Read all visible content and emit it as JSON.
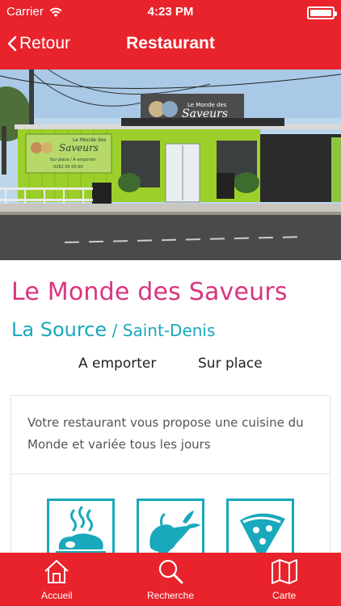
{
  "status_bar": {
    "carrier": "Carrier",
    "time": "4:23 PM",
    "battery_level": 1.0
  },
  "nav": {
    "back_label": "Retour",
    "title": "Restaurant"
  },
  "hero": {
    "sign_line1": "Le Monde des",
    "sign_line2": "Saveurs",
    "wall_line1": "Le Monde des",
    "wall_line2": "Saveurs",
    "wall_line3": "Sur place / A emporter",
    "wall_line4": "0262 00 00 00"
  },
  "restaurant": {
    "name": "Le Monde des Saveurs",
    "district": "La Source",
    "separator": "/",
    "city": "Saint-Denis",
    "tags": [
      "A emporter",
      "Sur place"
    ],
    "description": "Votre restaurant vous propose une cuisine du Monde et variée tous les jours"
  },
  "features": [
    {
      "icon": "grilled-meat-icon"
    },
    {
      "icon": "vegetables-icon"
    },
    {
      "icon": "pizza-icon"
    }
  ],
  "tabbar": {
    "items": [
      {
        "label": "Accueil",
        "icon": "home-icon"
      },
      {
        "label": "Recherche",
        "icon": "search-icon"
      },
      {
        "label": "Carte",
        "icon": "map-icon"
      }
    ]
  },
  "colors": {
    "brand_red": "#e8232b",
    "name_pink": "#d8357f",
    "accent_teal": "#19a8bc",
    "storefront_green": "#9ccf2a"
  }
}
